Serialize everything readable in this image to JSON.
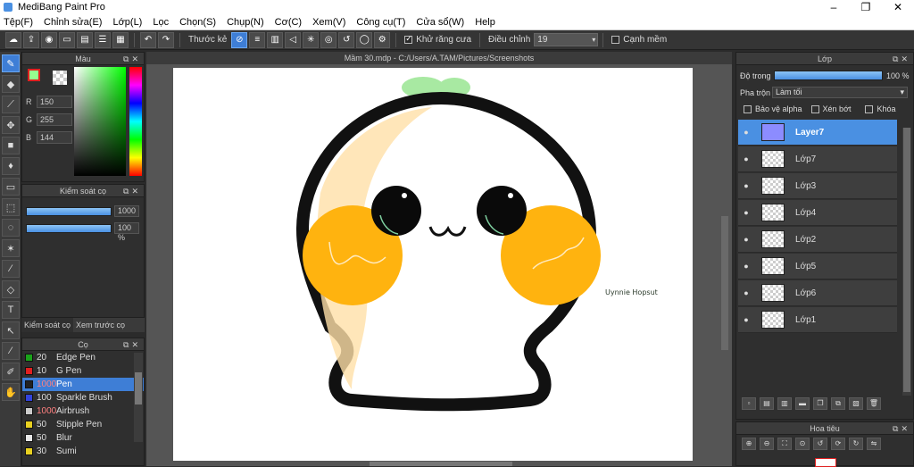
{
  "window": {
    "title": "MediBang Paint Pro",
    "controls": [
      "–",
      "❐",
      "✕"
    ]
  },
  "menu": [
    "Tệp(F)",
    "Chỉnh sửa(E)",
    "Lớp(L)",
    "Lọc",
    "Chọn(S)",
    "Chụp(N)",
    "Cơ(C)",
    "Xem(V)",
    "Công cụ(T)",
    "Cửa sổ(W)",
    "Help"
  ],
  "toolbar": {
    "ruler_label": "Thước kẻ",
    "antialias_label": "Khử răng cưa",
    "correction_label": "Điều chỉnh",
    "correction_value": "19",
    "sharp_label": "Cạnh mềm"
  },
  "color_panel": {
    "title": "Màu",
    "r_label": "R",
    "r_value": "150",
    "g_label": "G",
    "g_value": "255",
    "b_label": "B",
    "b_value": "144"
  },
  "brush_control": {
    "title": "Kiểm soát cọ",
    "size_value": "1000",
    "opacity_value": "100 %"
  },
  "subtabs": [
    "Kiểm soát cọ",
    "Xem trước cọ"
  ],
  "brush_panel": {
    "title": "Cọ",
    "items": [
      {
        "size": "20",
        "name": "Edge Pen",
        "color": "#1aa31a",
        "selected": false
      },
      {
        "size": "10",
        "name": "G Pen",
        "color": "#e02020",
        "selected": false
      },
      {
        "size": "1000",
        "name": "Pen",
        "color": "#222222",
        "selected": true
      },
      {
        "size": "100",
        "name": "Sparkle Brush",
        "color": "#3344dd",
        "selected": false
      },
      {
        "size": "1000",
        "name": "Airbrush",
        "color": "#cccccc",
        "selected": false
      },
      {
        "size": "50",
        "name": "Stipple Pen",
        "color": "#e8d020",
        "selected": false
      },
      {
        "size": "50",
        "name": "Blur",
        "color": "#e8e8e8",
        "selected": false
      },
      {
        "size": "30",
        "name": "Sumi",
        "color": "#e8d020",
        "selected": false
      }
    ]
  },
  "canvas": {
    "tab_title": "Mầm 30.mdp - C:/Users/A.TAM/Pictures/Screenshots",
    "signature": "Uynnie Hopsut"
  },
  "layer_panel": {
    "title": "Lớp",
    "opacity_label": "Độ trong",
    "opacity_value": "100 %",
    "blend_label": "Pha trộn",
    "blend_value": "Làm tối",
    "protect_alpha": "Bảo vệ alpha",
    "clipping": "Xén bớt",
    "lock": "Khóa",
    "layers": [
      {
        "name": "Layer7",
        "selected": true
      },
      {
        "name": "Lớp7",
        "selected": false
      },
      {
        "name": "Lớp3",
        "selected": false
      },
      {
        "name": "Lớp4",
        "selected": false
      },
      {
        "name": "Lớp2",
        "selected": false
      },
      {
        "name": "Lớp5",
        "selected": false
      },
      {
        "name": "Lớp6",
        "selected": false
      },
      {
        "name": "Lớp1",
        "selected": false
      }
    ]
  },
  "navigator": {
    "title": "Hoa tiêu"
  }
}
